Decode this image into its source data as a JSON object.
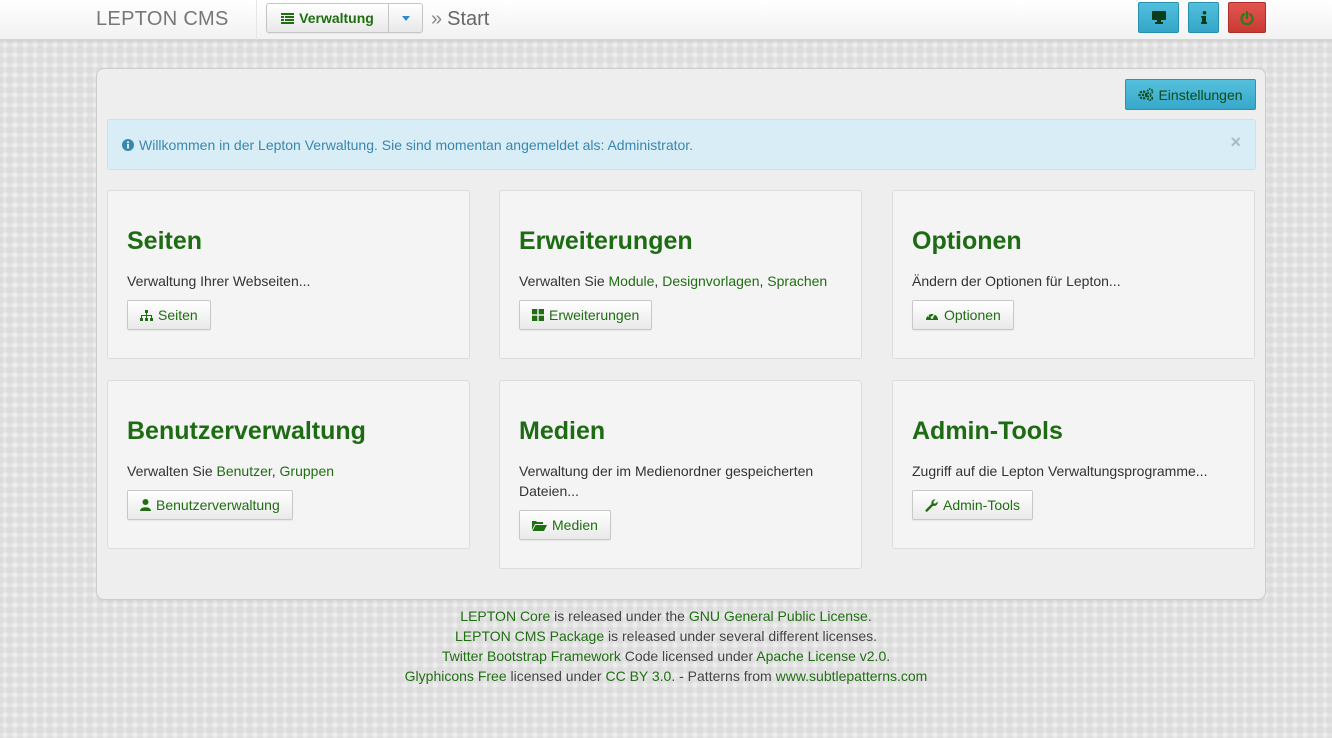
{
  "header": {
    "brand": "LEPTON CMS",
    "menu_label": "Verwaltung",
    "breadcrumb_sep": "»",
    "breadcrumb_current": "Start",
    "icons": [
      "desktop-icon",
      "info-icon",
      "power-icon"
    ]
  },
  "settings_label": "Einstellungen",
  "alert": {
    "text": "Willkommen in der Lepton Verwaltung. Sie sind momentan angemeldet als: Administrator.",
    "close": "×"
  },
  "cards": [
    {
      "title": "Seiten",
      "text_plain": "Verwaltung Ihrer Webseiten...",
      "button": "Seiten"
    },
    {
      "title": "Erweiterungen",
      "text_prefix": "Verwalten Sie ",
      "links": [
        "Module",
        "Designvorlagen",
        "Sprachen"
      ],
      "separators": [
        ", ",
        ", "
      ],
      "button": "Erweiterungen"
    },
    {
      "title": "Optionen",
      "text_plain": "Ändern der Optionen für Lepton...",
      "button": "Optionen"
    },
    {
      "title": "Benutzerverwaltung",
      "text_prefix": "Verwalten Sie ",
      "links": [
        "Benutzer",
        "Gruppen"
      ],
      "separators": [
        ", "
      ],
      "button": "Benutzerverwaltung"
    },
    {
      "title": "Medien",
      "text_plain": "Verwaltung der im Medienordner gespeicherten Dateien...",
      "button": "Medien"
    },
    {
      "title": "Admin-Tools",
      "text_plain": "Zugriff auf die Lepton Verwaltungsprogramme...",
      "button": "Admin-Tools"
    }
  ],
  "footer": {
    "line1": {
      "link1": "LEPTON Core",
      "text1": " is released under the ",
      "link2": "GNU General Public License",
      "text2": "."
    },
    "line2": {
      "link1": "LEPTON CMS Package",
      "text1": " is released under several different licenses."
    },
    "line3": {
      "link1": "Twitter Bootstrap Framework",
      "text1": " Code licensed under ",
      "link2": "Apache License v2.0",
      "text2": "."
    },
    "line4": {
      "link1": "Glyphicons Free",
      "text1": " licensed under ",
      "link2": "CC BY 3.0",
      "text2": ". - Patterns from ",
      "link3": "www.subtlepatterns.com"
    }
  },
  "colors": {
    "link_green": "#1f6e12",
    "title_green": "#1d6b12",
    "teal": "#3aaacb",
    "red": "#d2443d",
    "alert_bg": "#d9edf7",
    "alert_text": "#3a87ad"
  }
}
